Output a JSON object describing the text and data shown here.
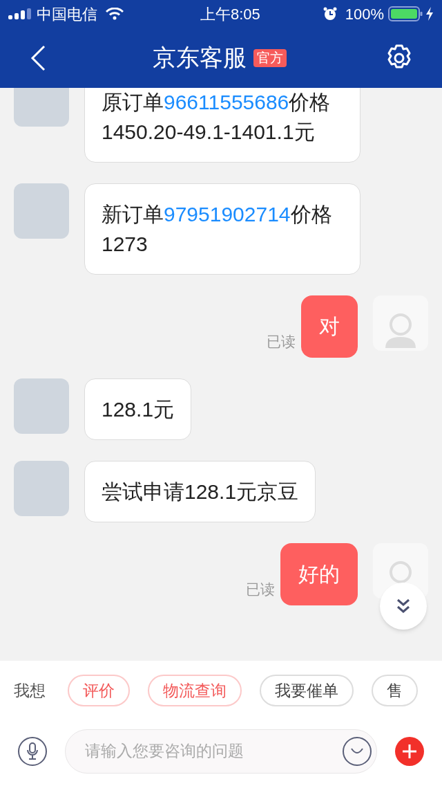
{
  "status_bar": {
    "carrier": "中国电信",
    "time": "上午8:05",
    "battery": "100%"
  },
  "nav": {
    "title": "京东客服",
    "badge": "官方"
  },
  "messages": [
    {
      "kind": "agent",
      "parts": [
        {
          "text": "原订单"
        },
        {
          "text": "96611555686",
          "link": true
        },
        {
          "text": "价格1450.20-49.1-1401.1元"
        }
      ]
    },
    {
      "kind": "agent",
      "parts": [
        {
          "text": "新订单"
        },
        {
          "text": "97951902714",
          "link": true
        },
        {
          "text": "价格1273"
        }
      ]
    },
    {
      "kind": "user",
      "parts": [
        {
          "text": "对"
        }
      ],
      "receipt": "已读"
    },
    {
      "kind": "agent",
      "parts": [
        {
          "text": "128.1元"
        }
      ]
    },
    {
      "kind": "agent",
      "parts": [
        {
          "text": "尝试申请128.1元京豆"
        }
      ]
    },
    {
      "kind": "user",
      "parts": [
        {
          "text": "好的"
        }
      ],
      "receipt": "已读"
    }
  ],
  "quick_bar": {
    "label": "我想",
    "chips": [
      {
        "text": "评价",
        "highlighted": true
      },
      {
        "text": "物流查询",
        "highlighted": true
      },
      {
        "text": "我要催单",
        "highlighted": false
      },
      {
        "text": "售",
        "highlighted": false
      }
    ]
  },
  "input": {
    "placeholder": "请输入您要咨询的问题"
  }
}
